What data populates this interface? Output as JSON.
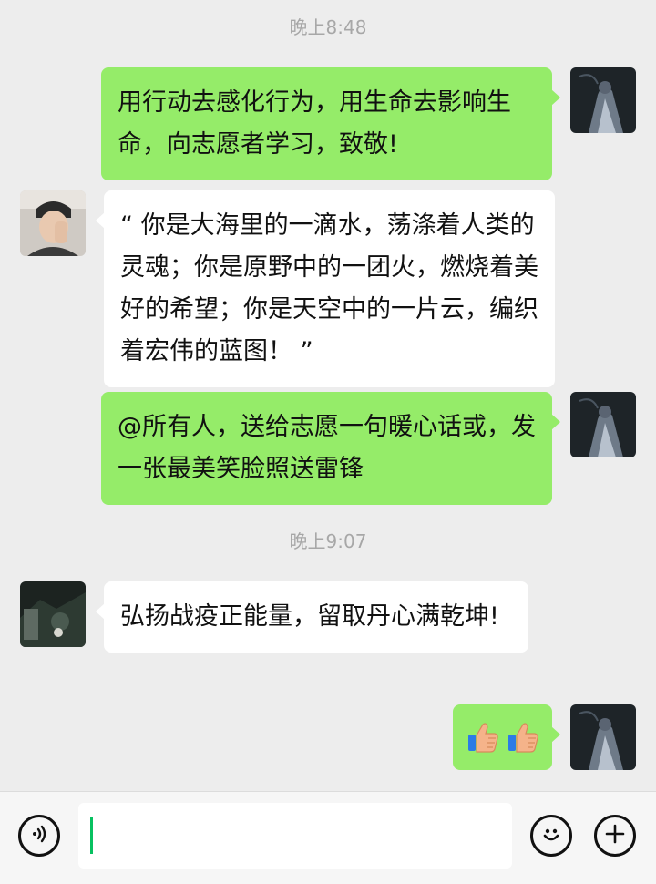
{
  "chat": {
    "timestamps": [
      "晚上8:48",
      "晚上9:07"
    ],
    "messages": [
      {
        "sender": "me",
        "text": "用行动去感化行为，用生命去影响生命，向志愿者学习，致敬!"
      },
      {
        "sender": "other",
        "text": "“ 你是大海里的一滴水，荡涤着人类的灵魂；你是原野中的一团火，燃烧着美好的希望；你是天空中的一片云，编织着宏伟的蓝图！ ”"
      },
      {
        "sender": "me",
        "text": "@所有人，送给志愿一句暖心话或，发一张最美笑脸照送雷锋"
      },
      {
        "sender": "other",
        "text": "弘扬战疫正能量，留取丹心满乾坤!"
      },
      {
        "sender": "me",
        "emoji": "thumbs-up-icon",
        "count": 2
      }
    ]
  },
  "input_bar": {
    "voice_icon": "voice-icon",
    "text_value": "",
    "emoji_icon": "smiley-icon",
    "more_icon": "plus-icon"
  },
  "colors": {
    "background": "#ededed",
    "my_bubble": "#95ec69",
    "other_bubble": "#ffffff",
    "timestamp": "#a7a7a7",
    "caret": "#07c160"
  }
}
